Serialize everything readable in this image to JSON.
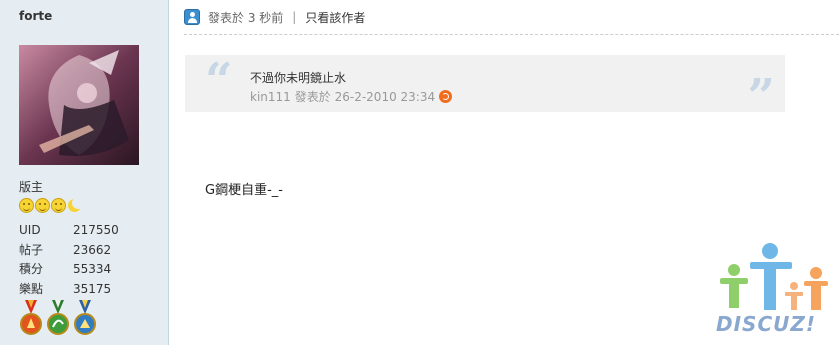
{
  "sidebar": {
    "username": "forte",
    "rank": "版主",
    "stats": [
      {
        "label": "UID",
        "value": "217550"
      },
      {
        "label": "帖子",
        "value": "23662"
      },
      {
        "label": "積分",
        "value": "55334"
      },
      {
        "label": "樂點",
        "value": "35175"
      }
    ],
    "medals": [
      {
        "name": "orange-medal",
        "color": "#e2531d"
      },
      {
        "name": "green-medal",
        "color": "#3e9d3a"
      },
      {
        "name": "blue-medal",
        "color": "#2f7cc4"
      }
    ]
  },
  "post": {
    "time": "發表於 3 秒前",
    "separator": "|",
    "only_author": "只看該作者",
    "quote": {
      "open_mark": "“",
      "close_mark": "”",
      "text": "不過你未明鏡止水",
      "author": "kin111",
      "meta": "發表於 26-2-2010 23:34"
    },
    "message": "G鋼梗自重-_-"
  },
  "logo": {
    "text": "DISCUZ!"
  },
  "colors": {
    "sidebar_bg": "#e5edf2",
    "quote_bg": "#f1f1f1",
    "quote_mark": "#c7d7e6",
    "logo_blue": "#8aa8cf"
  }
}
